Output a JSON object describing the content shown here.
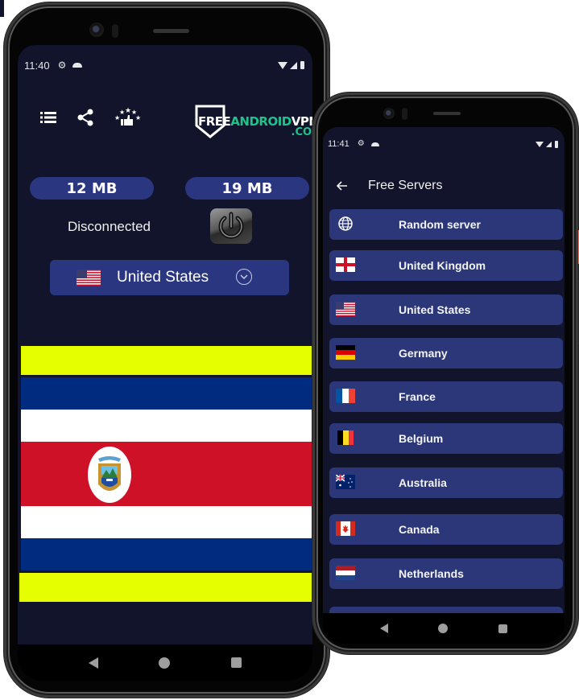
{
  "left_phone": {
    "status_bar": {
      "time": "11:40",
      "icons": [
        "gear-icon",
        "cloud-icon",
        "wifi-icon",
        "signal-icon",
        "battery-icon"
      ]
    },
    "toolbar": {
      "icons": [
        "list-icon",
        "share-icon",
        "rate-stars-thumbs-up-icon"
      ]
    },
    "logo": {
      "part1": "FREE",
      "part2": "ANDROID",
      "part3": "VPN",
      "part4": ".COM",
      "white": "#ffffff",
      "green": "#1ec38b"
    },
    "traffic": {
      "download": "12 MB",
      "upload": "19 MB"
    },
    "connection_status": "Disconnected",
    "power_button": {
      "icon": "power-icon"
    },
    "selected_country": {
      "name": "United States",
      "flag": "us-flag"
    },
    "displayed_flag": {
      "country": "Costa Rica",
      "colors": {
        "blue": "#002b7f",
        "white": "#ffffff",
        "red": "#ce1126",
        "frame": "#e6ff00"
      }
    },
    "navbar": [
      "back",
      "home",
      "recents"
    ]
  },
  "right_phone": {
    "status_bar": {
      "time": "11:41",
      "icons": [
        "gear-icon",
        "cloud-icon",
        "wifi-icon",
        "signal-icon",
        "battery-icon"
      ]
    },
    "appbar": {
      "title": "Free Servers",
      "back_icon": "arrow-left-icon"
    },
    "servers": [
      {
        "name": "Random server",
        "flag": "globe"
      },
      {
        "name": "United Kingdom",
        "flag": "gb-eng"
      },
      {
        "name": "United States",
        "flag": "us"
      },
      {
        "name": "Germany",
        "flag": "de"
      },
      {
        "name": "France",
        "flag": "fr"
      },
      {
        "name": "Belgium",
        "flag": "be"
      },
      {
        "name": "Australia",
        "flag": "au"
      },
      {
        "name": "Canada",
        "flag": "ca"
      },
      {
        "name": "Netherlands",
        "flag": "nl"
      }
    ],
    "navbar": [
      "back",
      "home",
      "recents"
    ]
  },
  "theme": {
    "background": "#11142a",
    "card": "#2b3778",
    "pill": "#2b3681"
  }
}
